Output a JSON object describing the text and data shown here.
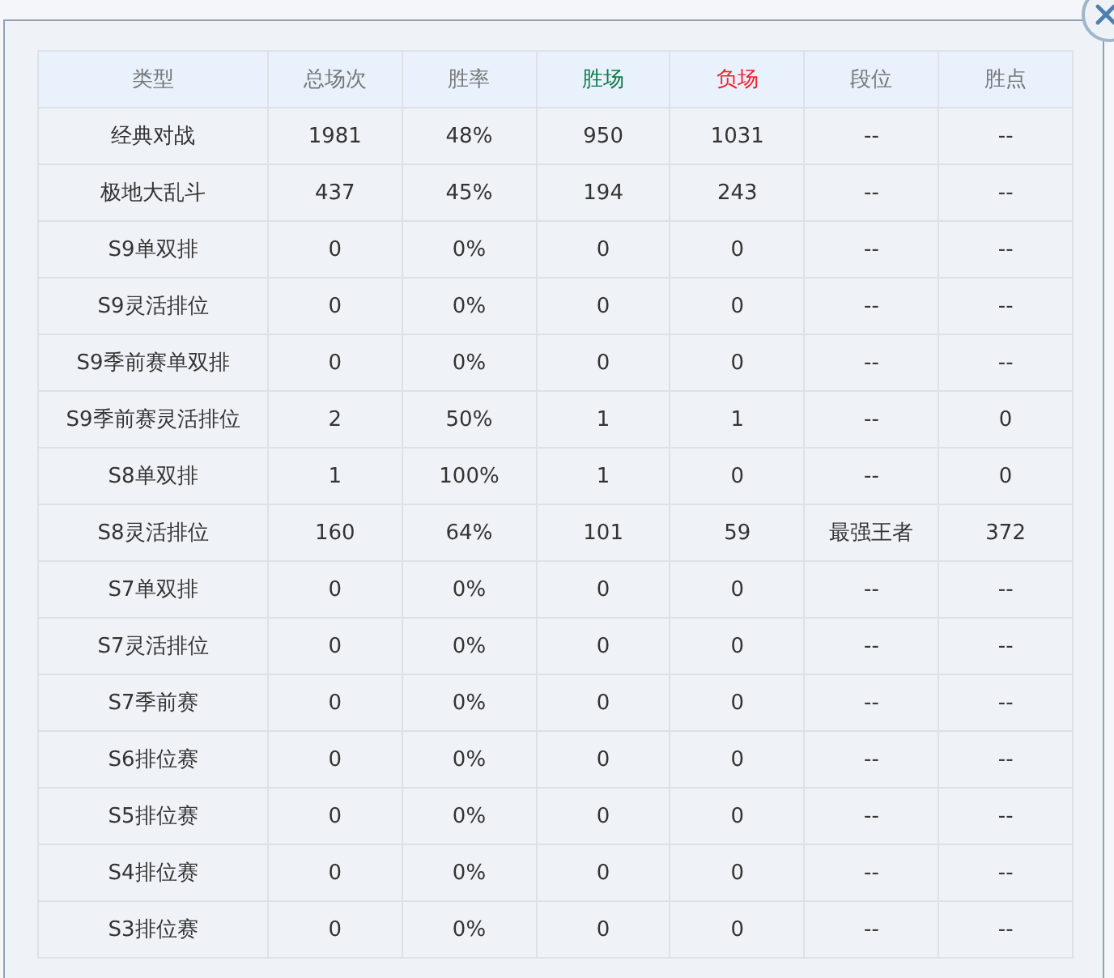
{
  "table": {
    "columns": [
      {
        "label": "类型",
        "color": "#777777"
      },
      {
        "label": "总场次",
        "color": "#777777"
      },
      {
        "label": "胜率",
        "color": "#777777"
      },
      {
        "label": "胜场",
        "color": "#0b7a45"
      },
      {
        "label": "负场",
        "color": "#f0212b"
      },
      {
        "label": "段位",
        "color": "#777777"
      },
      {
        "label": "胜点",
        "color": "#777777"
      }
    ],
    "rows": [
      [
        "经典对战",
        "1981",
        "48%",
        "950",
        "1031",
        "--",
        "--"
      ],
      [
        "极地大乱斗",
        "437",
        "45%",
        "194",
        "243",
        "--",
        "--"
      ],
      [
        "S9单双排",
        "0",
        "0%",
        "0",
        "0",
        "--",
        "--"
      ],
      [
        "S9灵活排位",
        "0",
        "0%",
        "0",
        "0",
        "--",
        "--"
      ],
      [
        "S9季前赛单双排",
        "0",
        "0%",
        "0",
        "0",
        "--",
        "--"
      ],
      [
        "S9季前赛灵活排位",
        "2",
        "50%",
        "1",
        "1",
        "--",
        "0"
      ],
      [
        "S8单双排",
        "1",
        "100%",
        "1",
        "0",
        "--",
        "0"
      ],
      [
        "S8灵活排位",
        "160",
        "64%",
        "101",
        "59",
        "最强王者",
        "372"
      ],
      [
        "S7单双排",
        "0",
        "0%",
        "0",
        "0",
        "--",
        "--"
      ],
      [
        "S7灵活排位",
        "0",
        "0%",
        "0",
        "0",
        "--",
        "--"
      ],
      [
        "S7季前赛",
        "0",
        "0%",
        "0",
        "0",
        "--",
        "--"
      ],
      [
        "S6排位赛",
        "0",
        "0%",
        "0",
        "0",
        "--",
        "--"
      ],
      [
        "S5排位赛",
        "0",
        "0%",
        "0",
        "0",
        "--",
        "--"
      ],
      [
        "S4排位赛",
        "0",
        "0%",
        "0",
        "0",
        "--",
        "--"
      ],
      [
        "S3排位赛",
        "0",
        "0%",
        "0",
        "0",
        "--",
        "--"
      ]
    ]
  }
}
